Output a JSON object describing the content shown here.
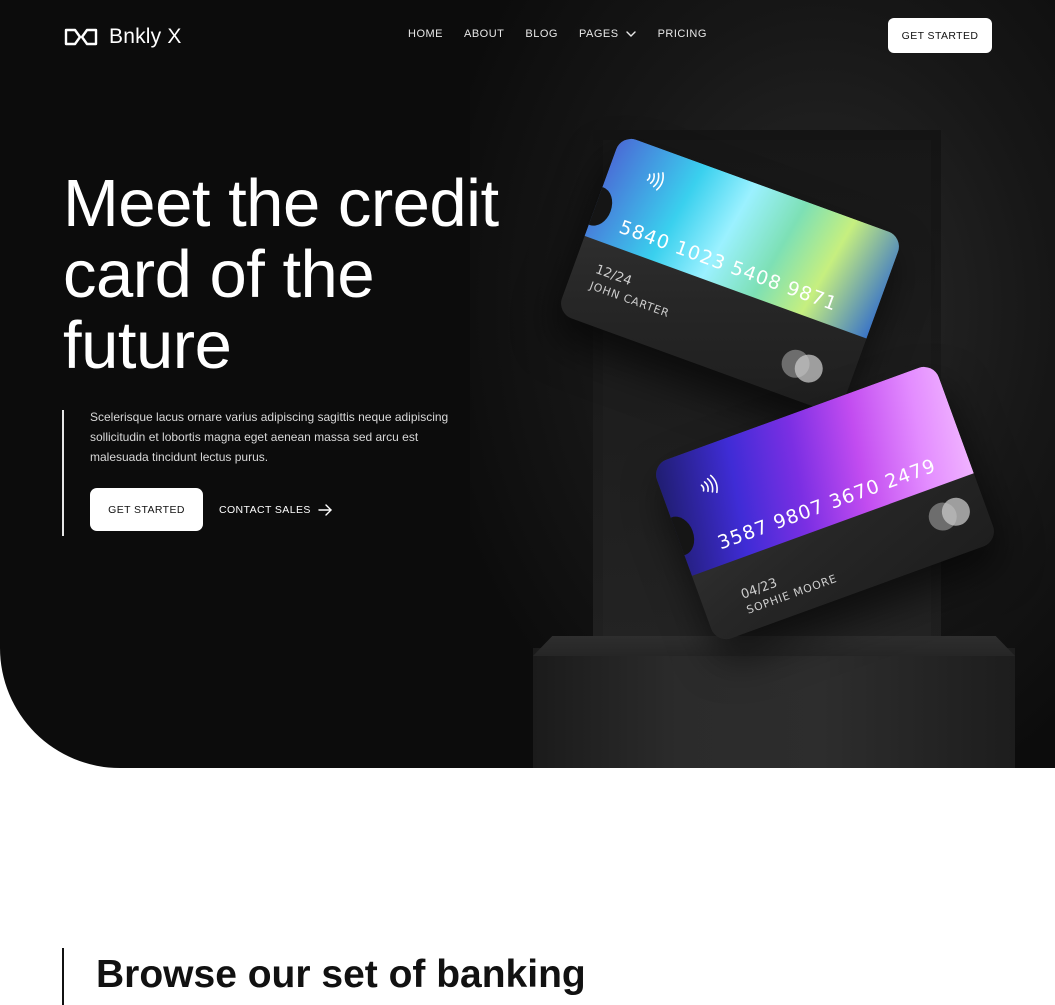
{
  "brand": {
    "name": "Bnkly X",
    "logo_icon": "infinity-logo-icon"
  },
  "nav": {
    "items": [
      {
        "label": "HOME"
      },
      {
        "label": "ABOUT"
      },
      {
        "label": "BLOG"
      },
      {
        "label": "PAGES",
        "icon": "chevron-down-icon"
      },
      {
        "label": "PRICING"
      }
    ],
    "cta_label": "GET STARTED"
  },
  "hero": {
    "headline": "Meet the credit card of the future",
    "description": "Scelerisque lacus ornare varius adipiscing sagittis neque adipiscing sollicitudin et lobortis magna eget aenean massa sed arcu est malesuada tincidunt lectus purus.",
    "primary_cta": "GET STARTED",
    "secondary_cta": "CONTACT SALES",
    "secondary_icon": "arrow-right-icon"
  },
  "cards": [
    {
      "number": "5840 1023 5408 9871",
      "expiry": "12/24",
      "holder": "JOHN CARTER",
      "colors": [
        "#3ad0ee",
        "#c6ef7f"
      ]
    },
    {
      "number": "3587 9807 3670 2479",
      "expiry": "04/23",
      "holder": "SOPHIE MOORE",
      "colors": [
        "#3f2cd6",
        "#e38cff"
      ]
    }
  ],
  "section": {
    "title": "Browse our set of banking"
  },
  "colors": {
    "hero_bg": "#0c0c0c",
    "text_on_dark": "#ffffff",
    "button_bg": "#ffffff"
  }
}
